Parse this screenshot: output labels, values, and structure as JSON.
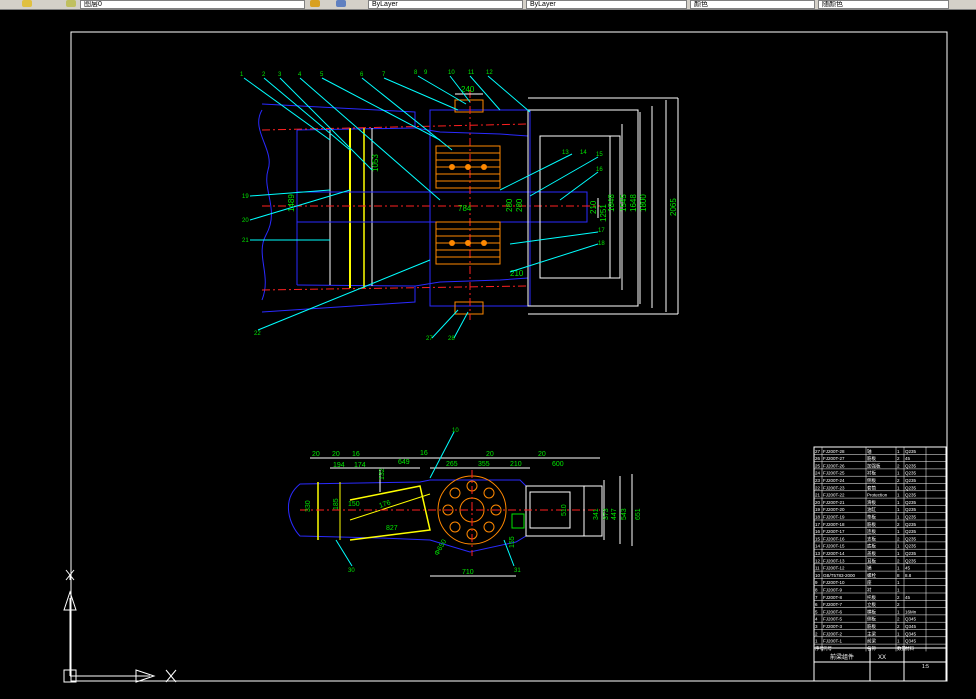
{
  "toolbar": {
    "layer_field": "图层0",
    "linetype_field": "ByLayer",
    "lineweight_field": "ByLayer",
    "color_field": "颜色",
    "plot_field": "随颜色"
  },
  "colors": {
    "background": "#000000",
    "frame": "#ffffff",
    "outline": "#2020ff",
    "dimension": "#00e600",
    "centerline": "#ff2020",
    "hatch": "#ffff00",
    "detail": "#ff8800",
    "leader": "#00ffff"
  },
  "top_view": {
    "dimensions": [
      "240",
      "1848",
      "1800",
      "1648",
      "1545",
      "2065",
      "1251",
      "210",
      "280",
      "280",
      "210",
      "784",
      "1489",
      "1053"
    ],
    "balloons": [
      "1",
      "2",
      "3",
      "4",
      "5",
      "6",
      "7",
      "8",
      "9",
      "10",
      "11",
      "12",
      "13",
      "14",
      "15",
      "16",
      "17",
      "18",
      "19",
      "20",
      "21",
      "22",
      "27",
      "28"
    ]
  },
  "side_view": {
    "dimensions": [
      "20",
      "20",
      "16",
      "194",
      "174",
      "649",
      "16",
      "265",
      "355",
      "20",
      "210",
      "20",
      "600",
      "132",
      "341",
      "373",
      "447",
      "543",
      "651",
      "510",
      "827",
      "176",
      "155",
      "710",
      "Φ650",
      "185",
      "330",
      "150"
    ],
    "balloons": [
      "10",
      "30",
      "31"
    ]
  },
  "title_block": {
    "rows": [
      {
        "no": "27",
        "code": "FJ200T-28",
        "name": "轴",
        "qty": "1",
        "mat": "Q235"
      },
      {
        "no": "26",
        "code": "FJ200T-27",
        "name": "筋板",
        "qty": "2",
        "mat": "45"
      },
      {
        "no": "25",
        "code": "FJ200T-26",
        "name": "加强板",
        "qty": "2",
        "mat": "Q235"
      },
      {
        "no": "24",
        "code": "FJ200T-25",
        "name": "衬板",
        "qty": "1",
        "mat": "Q235"
      },
      {
        "no": "23",
        "code": "FJ200T-24",
        "name": "侧板",
        "qty": "2",
        "mat": "Q235"
      },
      {
        "no": "22",
        "code": "FJ200T-23",
        "name": "套筒",
        "qty": "1",
        "mat": "Q235"
      },
      {
        "no": "21",
        "code": "FJ200T-22",
        "name": "Protection",
        "qty": "1",
        "mat": "Q235"
      },
      {
        "no": "20",
        "code": "FJ200T-21",
        "name": "滑板",
        "qty": "1",
        "mat": "Q235"
      },
      {
        "no": "19",
        "code": "FJ200T-20",
        "name": "油缸",
        "qty": "1",
        "mat": "Q235"
      },
      {
        "no": "18",
        "code": "FJ200T-19",
        "name": "垫板",
        "qty": "1",
        "mat": "Q235"
      },
      {
        "no": "17",
        "code": "FJ200T-18",
        "name": "筋板",
        "qty": "2",
        "mat": "Q235"
      },
      {
        "no": "16",
        "code": "FJ200T-17",
        "name": "连板",
        "qty": "1",
        "mat": "Q235"
      },
      {
        "no": "15",
        "code": "FJ200T-16",
        "name": "支板",
        "qty": "2",
        "mat": "Q235"
      },
      {
        "no": "14",
        "code": "FJ200T-15",
        "name": "底板",
        "qty": "1",
        "mat": "Q235"
      },
      {
        "no": "13",
        "code": "FJ200T-14",
        "name": "盖板",
        "qty": "1",
        "mat": "Q235"
      },
      {
        "no": "12",
        "code": "FJ200T-13",
        "name": "耳板",
        "qty": "2",
        "mat": "Q235"
      },
      {
        "no": "11",
        "code": "FJ200T-12",
        "name": "销",
        "qty": "1",
        "mat": "45"
      },
      {
        "no": "10",
        "code": "GB/T5783-2000",
        "name": "螺栓",
        "qty": "8",
        "mat": "8.8"
      },
      {
        "no": "9",
        "code": "FJ200T-10",
        "name": "座",
        "qty": "1",
        "mat": ""
      },
      {
        "no": "8",
        "code": "FJ200T-9",
        "name": "衬",
        "qty": "1",
        "mat": ""
      },
      {
        "no": "7",
        "code": "FJ200T-8",
        "name": "托板",
        "qty": "2",
        "mat": "45"
      },
      {
        "no": "6",
        "code": "FJ200T-7",
        "name": "立板",
        "qty": "2",
        "mat": ""
      },
      {
        "no": "5",
        "code": "FJ200T-6",
        "name": "横板",
        "qty": "1",
        "mat": "16Mn"
      },
      {
        "no": "4",
        "code": "FJ200T-5",
        "name": "侧板",
        "qty": "2",
        "mat": "Q345"
      },
      {
        "no": "3",
        "code": "FJ200T-3",
        "name": "筋板",
        "qty": "2",
        "mat": "Q345"
      },
      {
        "no": "2",
        "code": "FJ200T-2",
        "name": "主梁",
        "qty": "1",
        "mat": "Q345"
      },
      {
        "no": "1",
        "code": "FJ200T-1",
        "name": "前梁",
        "qty": "1",
        "mat": "Q345"
      }
    ],
    "header": {
      "no": "序号",
      "code": "代号",
      "name": "名称",
      "qty": "数量",
      "mat": "材料"
    },
    "title": "前梁组件",
    "org": "XX",
    "scale": "1:5"
  },
  "ucs": {
    "x_label": "X",
    "y_label": "Y"
  }
}
